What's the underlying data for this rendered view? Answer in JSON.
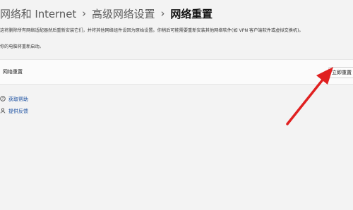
{
  "breadcrumb": {
    "item1": "网络和 Internet",
    "item2": "高级网络设置",
    "current": "网络重置",
    "separator": "›"
  },
  "description": {
    "line1": "这将删除所有网络适配器然后重新安装它们，并将其他网络组件设回为原始设置。你稍后可能需要重新安装其他网络软件(如 VPN 客户端软件或虚拟交换机)。",
    "line2": "你的电脑将重新启动。"
  },
  "reset_card": {
    "label": "网络重置",
    "button_label": "立即重置"
  },
  "help": {
    "get_help": "获取帮助",
    "feedback": "提供反馈"
  },
  "annotation": {
    "arrow_color": "#e02020"
  },
  "colors": {
    "background": "#f3f3f3",
    "link": "#1a4fa0"
  }
}
